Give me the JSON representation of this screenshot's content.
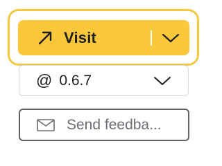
{
  "visit_button": {
    "label": "Visit",
    "icon": "arrow-up-right-icon",
    "dropdown_icon": "chevron-down-icon",
    "background_color": "#fbc73b",
    "focus_ring_color": "#f5c842"
  },
  "version_select": {
    "prefix": "@",
    "value": "0.6.7",
    "dropdown_icon": "chevron-down-icon"
  },
  "feedback_button": {
    "label": "Send feedba...",
    "icon": "mail-icon"
  }
}
